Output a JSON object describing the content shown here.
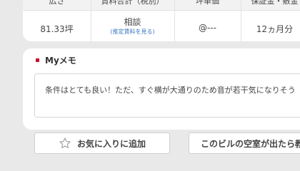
{
  "summary": {
    "headers": {
      "area": "広さ",
      "rent_total": "賃料合計（税別）",
      "tsubo_price": "坪単価",
      "deposit": "保証金・敷金"
    },
    "values": {
      "area": "81.33坪",
      "rent_total": "相談",
      "rent_link": "(推定賃料を見る)",
      "tsubo_price": "@---",
      "deposit": "12ヵ月分"
    }
  },
  "memo": {
    "title": "Myメモ",
    "text": "条件はとても良い！ただ、すぐ横が大通りのため音が若干気になりそう",
    "accent": "#c8102e"
  },
  "buttons": {
    "favorite": {
      "label": "お気に入りに追加",
      "icon": "star-outline-icon"
    },
    "notify": {
      "label": "このビルの空室が出たら教えて"
    }
  }
}
